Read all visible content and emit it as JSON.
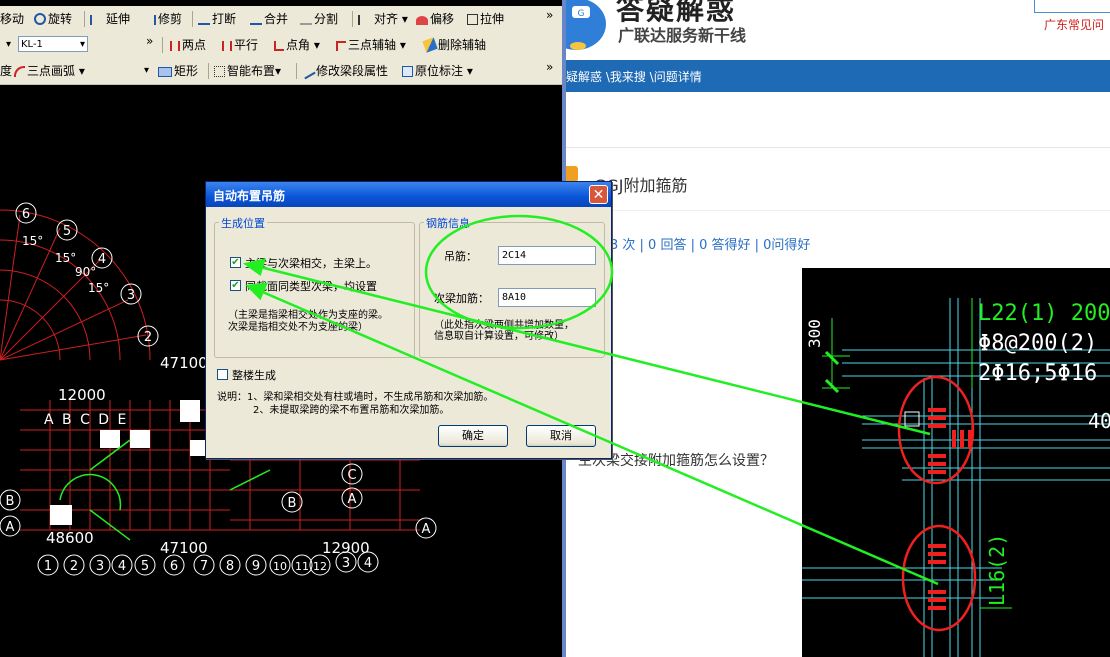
{
  "left_app": {
    "toolbar1": {
      "move": "移动",
      "rotate": "旋转",
      "extend": "延伸",
      "trim": "修剪",
      "break": "打断",
      "merge": "合并",
      "split": "分割",
      "align": "对齐",
      "offset": "偏移",
      "stretch": "拉伸",
      "more": "»"
    },
    "toolbar2": {
      "beam_select": "KL-1",
      "two_points": "两点",
      "parallel": "平行",
      "point_angle": "点角",
      "three_point_axis": "三点辅轴",
      "delete_axis": "删除辅轴",
      "more": "»"
    },
    "toolbar3": {
      "partial": "度",
      "three_point_arc": "三点画弧",
      "rect": "矩形",
      "smart_layout": "智能布置",
      "modify_span_attr": "修改梁段属性",
      "in_situ_label": "原位标注",
      "more": "»"
    },
    "cad_labels": {
      "circles": [
        "6",
        "5",
        "4",
        "3",
        "2",
        "1",
        "2",
        "3",
        "4",
        "5",
        "6",
        "7",
        "8",
        "9",
        "10",
        "11",
        "12",
        "2",
        "3",
        "4",
        "A",
        "A",
        "B",
        "B",
        "C",
        "C",
        "D",
        "E",
        "B",
        "A"
      ],
      "dims": [
        "47100",
        "12000",
        "48600",
        "47100",
        "12900",
        "15°",
        "15°",
        "90°",
        "15°"
      ],
      "grid_letters": "A B C D E"
    }
  },
  "dialog": {
    "title": "自动布置吊筋",
    "close": "✕",
    "group_position": "生成位置",
    "opt1": "主梁与次梁相交，主梁上。",
    "opt2": "同截面同类型次梁，均设置",
    "note1": "（主梁是指梁相交处作为支座的梁。",
    "note2": "次梁是指相交处不为支座的梁）",
    "group_rebar": "钢筋信息",
    "hanger_label": "吊筋：",
    "hanger_value": "2C14",
    "stirrup_label": "次梁加筋：",
    "stirrup_value": "8A10",
    "rebar_note1": "（此处指次梁两侧共增加数量，",
    "rebar_note2": "信息取自计算设置，可修改）",
    "whole_floor": "整楼生成",
    "explain1": "说明：1、梁和梁相交处有柱或墙时，不生成吊筋和次梁加筋。",
    "explain2": "2、未提取梁跨的梁不布置吊筋和次梁加筋。",
    "ok": "确定",
    "cancel": "取消"
  },
  "right_page": {
    "brand": "答疑解惑",
    "slogan": "广联达服务新干线",
    "region": "广东常见问",
    "breadcrumb": "疑解惑 \\我来搜 \\问题详情",
    "question_title": "GGJ附加箍筋",
    "stats": "3 次 | 0 回答 | 0 答得好 | 0问得好",
    "question_text": "主次梁交接附加箍筋怎么设置？",
    "drawing": {
      "label_top1": "L22(1) 200",
      "label_top2": "Φ8@200(2)",
      "label_top3": "2Φ16;5Φ16",
      "label_300": "300",
      "label_40": "40",
      "label_bottom": "L16(2)"
    }
  },
  "colors": {
    "accent_green": "#22ee22",
    "nav_blue": "#1f6ab5",
    "dialog_title": "#0a54d8",
    "cad_red": "#cc2020"
  }
}
